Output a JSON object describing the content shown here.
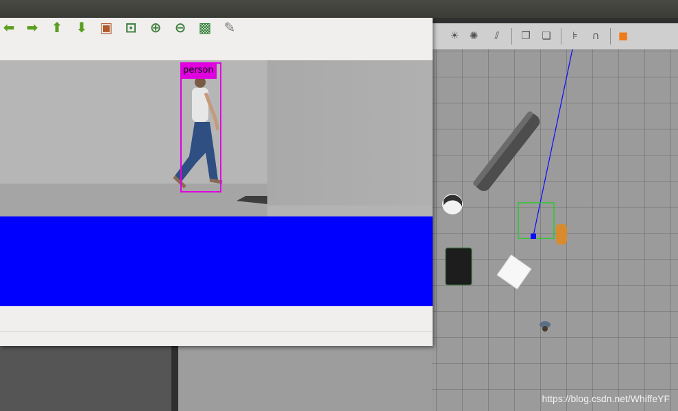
{
  "image_view": {
    "toolbar": [
      {
        "name": "back-arrow-icon",
        "glyph": "⬅",
        "color": "#5a9e1e"
      },
      {
        "name": "forward-arrow-icon",
        "glyph": "➡",
        "color": "#5a9e1e"
      },
      {
        "name": "up-arrow-icon",
        "glyph": "⬆",
        "color": "#5a9e1e"
      },
      {
        "name": "down-arrow-icon",
        "glyph": "⬇",
        "color": "#5a9e1e"
      },
      {
        "name": "image-icon",
        "glyph": "▣",
        "color": "#b05a2a"
      },
      {
        "name": "zoom-fit-icon",
        "glyph": "⊡",
        "color": "#3f7f3f"
      },
      {
        "name": "zoom-in-icon",
        "glyph": "⊕",
        "color": "#3f7f3f"
      },
      {
        "name": "zoom-out-icon",
        "glyph": "⊖",
        "color": "#3f7f3f"
      },
      {
        "name": "save-icon",
        "glyph": "▩",
        "color": "#2e7d32"
      },
      {
        "name": "clear-icon",
        "glyph": "✎",
        "color": "#777777"
      }
    ],
    "detection": {
      "label": "person",
      "color": "#e000e0"
    }
  },
  "gazebo": {
    "toolbar": [
      {
        "name": "sun-light-icon",
        "glyph": "☀"
      },
      {
        "name": "point-light-icon",
        "glyph": "✺"
      },
      {
        "name": "directional-light-icon",
        "glyph": "⫽"
      },
      {
        "name": "copy-icon",
        "glyph": "❐"
      },
      {
        "name": "paste-icon",
        "glyph": "❏"
      },
      {
        "name": "align-icon",
        "glyph": "⊧"
      },
      {
        "name": "magnet-icon",
        "glyph": "∩"
      },
      {
        "name": "view-cube-icon",
        "glyph": "■"
      }
    ]
  },
  "watermark": "https://blog.csdn.net/WhiffeYF"
}
